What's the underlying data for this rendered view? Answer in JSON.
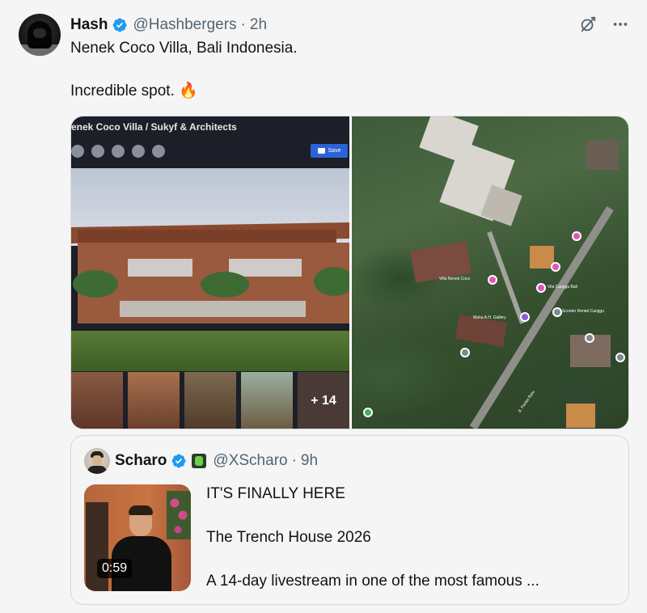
{
  "tweet": {
    "author_name": "Hash",
    "author_handle": "@Hashbergers",
    "separator": "·",
    "time": "2h",
    "text_line1": "Nenek Coco Villa, Bali Indonesia.",
    "text_line2": "Incredible spot. 🔥",
    "icons": {
      "verified": "verified-badge-icon",
      "grok": "grok-icon",
      "more": "more-options-icon"
    },
    "accent_color": "#1d9bf0"
  },
  "media": {
    "left_image": {
      "site_title": "enek Coco Villa / Sukyf & Architects",
      "save_label": "Save",
      "more_count": "+ 14"
    },
    "right_image": {
      "type": "satellite-map",
      "labels": [
        "Villa Nenek Coco",
        "Maha A.H. Gallery",
        "Vila Canggu Bali",
        "Scooter Rental Canggu",
        "Jl. Pantai Batu"
      ]
    }
  },
  "quote": {
    "author_name": "Scharo",
    "author_handle": "@XScharo",
    "separator": "·",
    "time": "9h",
    "video_duration": "0:59",
    "text_line1": "IT'S FINALLY HERE",
    "text_line2": "The Trench House 2026",
    "text_line3": "A 14-day livestream in one of the most famous ..."
  }
}
